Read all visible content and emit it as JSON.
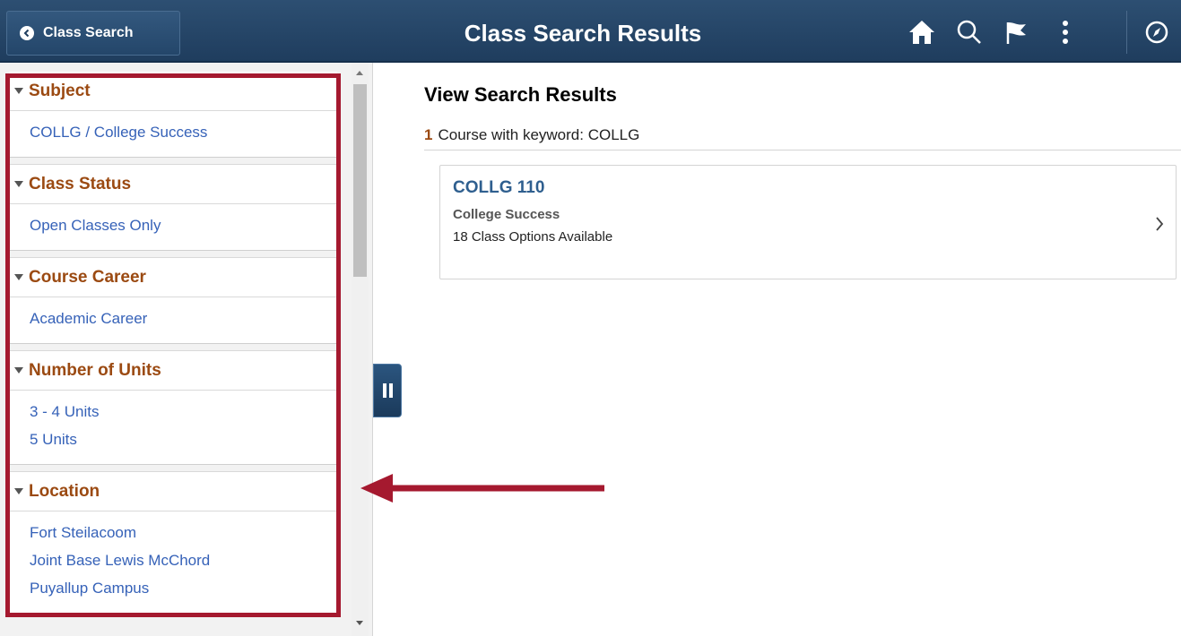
{
  "header": {
    "back_label": "Class Search",
    "title": "Class Search Results",
    "icons": [
      "home-icon",
      "search-icon",
      "flag-icon",
      "more-options-icon",
      "navbar-compass-icon"
    ]
  },
  "filters": [
    {
      "heading": "Subject",
      "options": [
        "COLLG / College Success"
      ]
    },
    {
      "heading": "Class Status",
      "options": [
        "Open Classes Only"
      ]
    },
    {
      "heading": "Course Career",
      "options": [
        "Academic Career"
      ]
    },
    {
      "heading": "Number of Units",
      "options": [
        "3 - 4 Units",
        "5 Units"
      ]
    },
    {
      "heading": "Location",
      "options": [
        "Fort Steilacoom",
        "Joint Base Lewis McChord",
        "Puyallup Campus"
      ]
    }
  ],
  "results": {
    "title": "View Search Results",
    "count": "1",
    "count_text": "Course with keyword: COLLG",
    "courses": [
      {
        "code": "COLLG 110",
        "name": "College Success",
        "options": "18 Class Options Available"
      }
    ]
  },
  "colors": {
    "header_bg": "#1f3d5e",
    "filter_heading": "#9b4a12",
    "link": "#3662b8",
    "highlight": "#a5192f",
    "course_code": "#2f5f8f"
  }
}
